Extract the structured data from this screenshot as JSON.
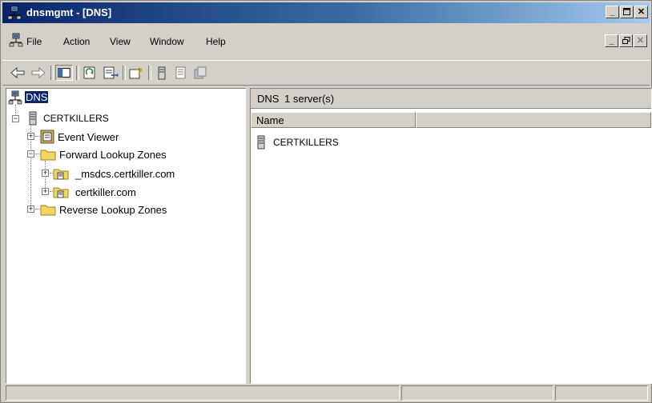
{
  "window": {
    "title": "dnsmgmt - [DNS]",
    "min": "_",
    "max": "□",
    "close": "✕"
  },
  "menubar": {
    "items": [
      {
        "label": "File"
      },
      {
        "label": "Action"
      },
      {
        "label": "View"
      },
      {
        "label": "Window"
      },
      {
        "label": "Help"
      }
    ]
  },
  "toolbar": {
    "back_icon": "back-arrow-icon",
    "forward_icon": "forward-arrow-icon"
  },
  "tree": {
    "root": "DNS",
    "server": "CERTKILLERS",
    "event_viewer": "Event Viewer",
    "forward_zones": "Forward Lookup Zones",
    "zone1": "_msdcs.certkiller.com",
    "zone2": "certkiller.com",
    "reverse_zones": "Reverse Lookup Zones"
  },
  "list": {
    "header_title": "DNS",
    "header_count": "1 server(s)",
    "column_name": "Name",
    "rows": [
      {
        "name": "CERTKILLERS"
      }
    ]
  },
  "colors": {
    "titlebar_start": "#0a246a",
    "titlebar_end": "#a6caf0",
    "face": "#d4d0c8",
    "selection": "#0a246a"
  }
}
